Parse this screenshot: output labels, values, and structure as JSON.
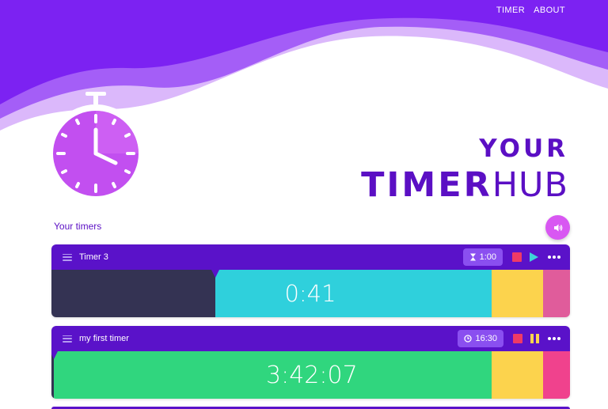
{
  "nav": {
    "items": [
      "TIMER",
      "ABOUT"
    ]
  },
  "hero": {
    "title_line1": "YOUR",
    "title_bold": "TIMER",
    "title_light": "HUB",
    "icon": "stopwatch-icon"
  },
  "section_label": "Your timers",
  "sound_button": {
    "icon": "speaker-icon"
  },
  "timers": [
    {
      "name": "Timer 3",
      "duration_icon": "hourglass-icon",
      "duration": "1:00",
      "remaining": "0:41",
      "state": "paused",
      "controls": [
        "stop-icon",
        "play-icon",
        "more-icon"
      ],
      "progress_elapsed": 0.32
    },
    {
      "name": "my first timer",
      "duration_icon": "clock-icon",
      "duration": "16:30",
      "remaining": "3:42:07",
      "state": "running",
      "controls": [
        "stop-icon",
        "pause-icon",
        "more-icon"
      ],
      "progress_elapsed": 0.0
    }
  ],
  "colors": {
    "brand_purple": "#5a12c9",
    "hero_purple": "#7c22f2",
    "hero_mid": "#a45ef7",
    "hero_light": "#dbb8fb",
    "elapsed": "#343353",
    "cyan": "#2fd0dc",
    "green": "#30d67e",
    "yellow": "#fcd34d",
    "pink": "#e05c9b",
    "hotpink": "#f0428d",
    "stop_red": "#ef3a66",
    "sound_button": "#d857f2"
  }
}
